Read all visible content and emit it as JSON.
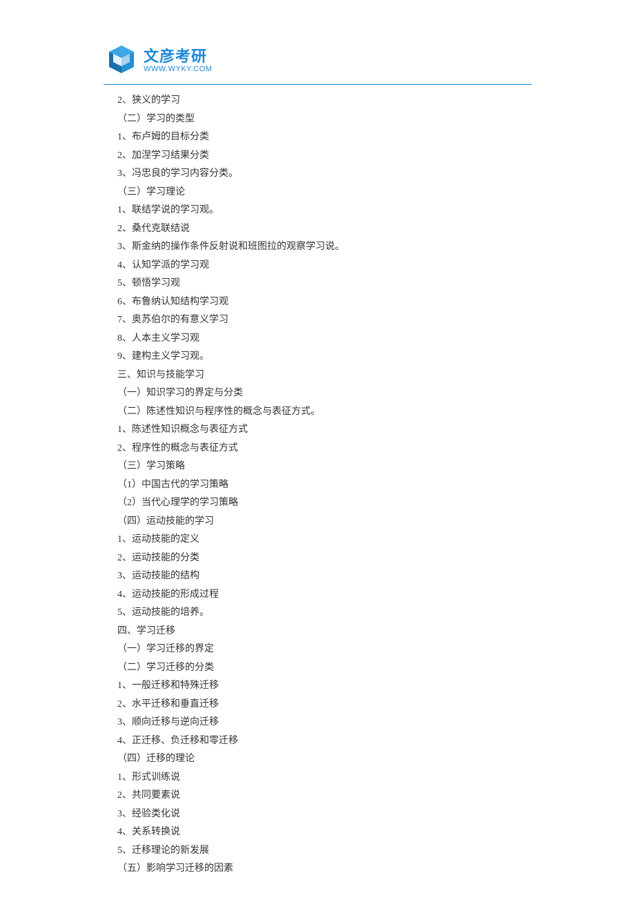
{
  "logo": {
    "title": "文彦考研",
    "url": "WWW.WYKY.COM"
  },
  "outline": [
    "2、狭义的学习",
    "（二）学习的类型",
    "1、布卢姆的目标分类",
    "2、加涅学习结果分类",
    "3、冯忠良的学习内容分类。",
    "（三）学习理论",
    "1、联结学说的学习观。",
    "2、桑代克联结说",
    "3、斯金纳的操作条件反射说和班图拉的观察学习说。",
    "4、认知学派的学习观",
    "5、顿悟学习观",
    "6、布鲁纳认知结构学习观",
    "7、奥苏伯尔的有意义学习",
    "8、人本主义学习观",
    "9、建构主义学习观。",
    "三、知识与技能学习",
    "（一）知识学习的界定与分类",
    "（二）陈述性知识与程序性的概念与表征方式。",
    "1、陈述性知识概念与表征方式",
    "2、程序性的概念与表征方式",
    "（三）学习策略",
    "（1）中国古代的学习策略",
    "（2）当代心理学的学习策略",
    "（四）运动技能的学习",
    "1、运动技能的定义",
    "2、运动技能的分类",
    "3、运动技能的结构",
    "4、运动技能的形成过程",
    "5、运动技能的培养。",
    "四、学习迁移",
    "（一）学习迁移的界定",
    "（二）学习迁移的分类",
    "1、一般迁移和特殊迁移",
    "2、水平迁移和垂直迁移",
    "3、顺向迁移与逆向迁移",
    "4、正迁移、负迁移和零迁移",
    "（四）迁移的理论",
    "1、形式训练说",
    "2、共同要素说",
    "3、经验类化说",
    "4、关系转换说",
    "5、迁移理论的新发展",
    "（五）影响学习迁移的因素"
  ]
}
